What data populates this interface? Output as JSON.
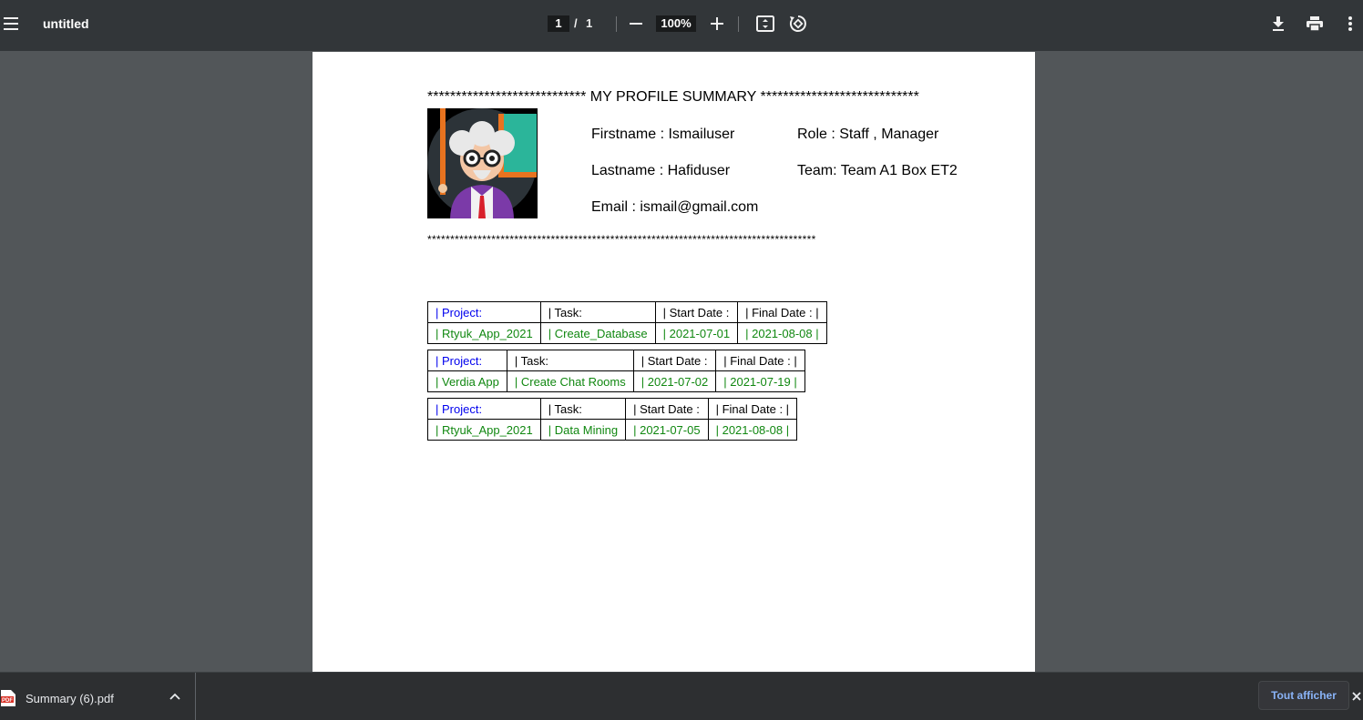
{
  "toolbar": {
    "menu_icon": "hamburger-icon",
    "title": "untitled",
    "current_page": "1",
    "page_separator": "/",
    "total_pages": "1",
    "zoom_out_icon": "minus-icon",
    "zoom_level": "100%",
    "zoom_in_icon": "plus-icon",
    "fit_icon": "fit-to-page-icon",
    "rotate_icon": "rotate-icon",
    "download_icon": "download-icon",
    "print_icon": "print-icon",
    "more_icon": "more-vert-icon"
  },
  "document": {
    "header_line": "**************************** MY PROFILE SUMMARY ****************************",
    "footer_line": "*************************************************************************************",
    "profile": {
      "firstname": "Firstname : Ismailuser",
      "lastname": "Lastname : Hafiduser",
      "email": "Email : ismail@gmail.com",
      "role": "Role : Staff , Manager",
      "team": "Team: Team A1 Box ET2"
    },
    "projects": [
      {
        "h_project": "| Project:",
        "h_task": "| Task:",
        "h_start": "| Start Date :",
        "h_final": "| Final Date : |",
        "project": "| Rtyuk_App_2021",
        "task": "| Create_Database",
        "start": "| 2021-07-01",
        "final": "| 2021-08-08 |"
      },
      {
        "h_project": "| Project:",
        "h_task": "| Task:",
        "h_start": "| Start Date :",
        "h_final": "| Final Date : |",
        "project": "| Verdia App",
        "task": "| Create Chat Rooms",
        "start": "| 2021-07-02",
        "final": "| 2021-07-19 |"
      },
      {
        "h_project": "| Project:",
        "h_task": "| Task:",
        "h_start": "| Start Date :",
        "h_final": "| Final Date : |",
        "project": "| Rtyuk_App_2021",
        "task": "| Data Mining",
        "start": "| 2021-07-05",
        "final": "| 2021-08-08 |"
      }
    ]
  },
  "downloads": {
    "file_name": "Summary (6).pdf",
    "file_icon": "pdf-file-icon",
    "show_all_label": "Tout afficher"
  },
  "colors": {
    "toolbar_bg": "#323639",
    "viewer_bg": "#525659",
    "header_label_color": "#0000ee",
    "value_color": "#118811",
    "link_blue": "#8ab4f8"
  }
}
